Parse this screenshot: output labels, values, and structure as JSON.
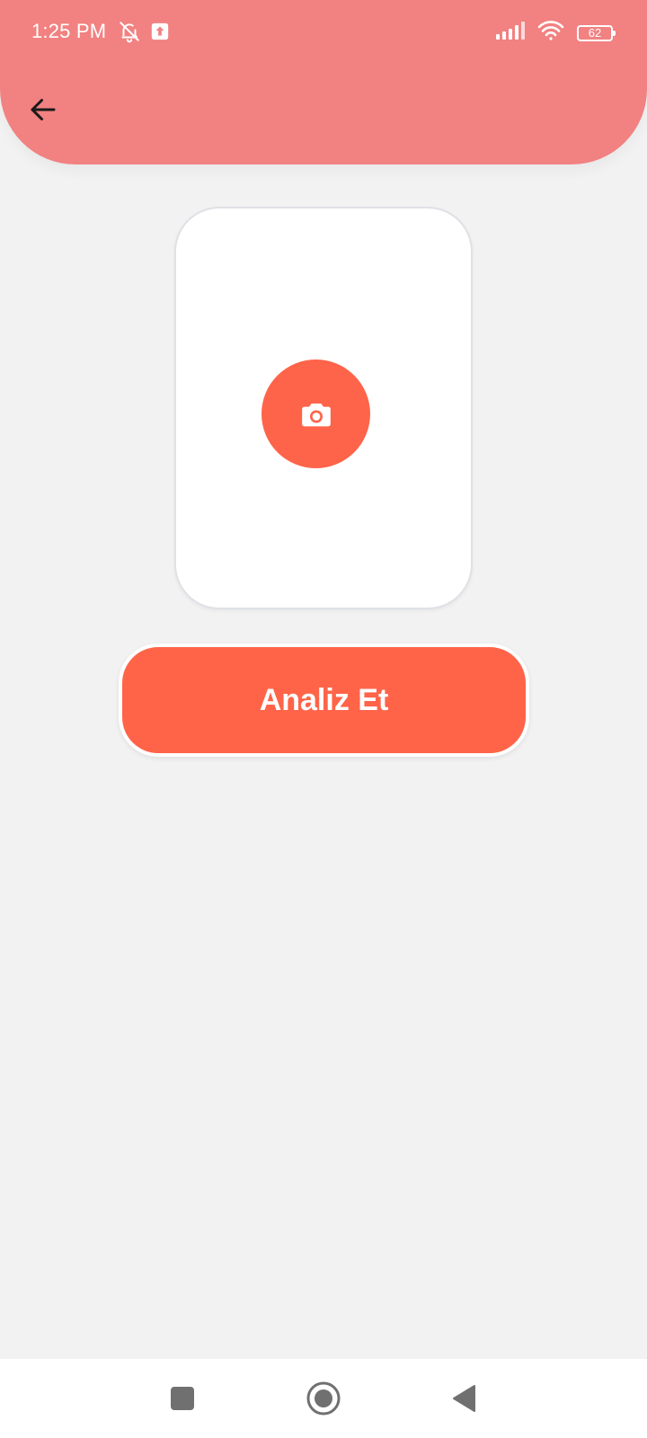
{
  "status_bar": {
    "time": "1:25 PM",
    "battery": "62",
    "icons": [
      "bell-muted-icon",
      "upload-notification-icon",
      "signal-icon",
      "wifi-icon",
      "battery-icon"
    ]
  },
  "header": {
    "back_icon": "arrow-left-icon"
  },
  "main": {
    "camera_icon": "camera-icon",
    "analyze_label": "Analiz Et"
  },
  "nav_bar": {
    "icons": [
      "recents-square-icon",
      "home-circle-icon",
      "back-triangle-icon"
    ]
  },
  "colors": {
    "header": "#f28181",
    "accent": "#fe6449",
    "background": "#f2f2f2",
    "card": "#ffffff"
  }
}
